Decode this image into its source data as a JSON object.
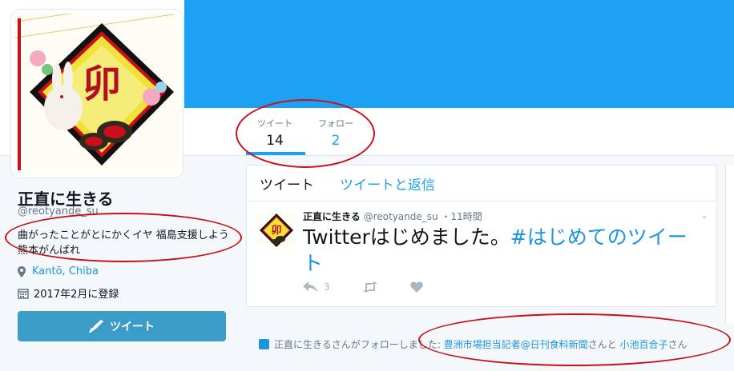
{
  "profile": {
    "name": "正直に生きる",
    "handle": "@reotyande_su",
    "bio": "曲がったことがとにかくイヤ 福島支援しよう 熊本がんばれ",
    "location": "Kantō, Chiba",
    "joined": "2017年2月に登録",
    "avatar_kanji": "卯",
    "tweet_button_label": "ツイート"
  },
  "stats": {
    "tweets_label": "ツイート",
    "tweets_value": "14",
    "following_label": "フォロー",
    "following_value": "2"
  },
  "timeline": {
    "tabs": [
      "ツイート",
      "ツイートと返信"
    ],
    "tweet": {
      "author": "正直に生きる",
      "handle": "@reotyande_su",
      "time": "・11時間",
      "text": "Twitterはじめました。",
      "hashtag": "#はじめてのツイート",
      "reply_count": "3"
    }
  },
  "follow_notice": {
    "prefix": "正直に生きるさんがフォローしました: ",
    "account1": "豊洲市場担当記者@日刊食料新聞",
    "middle": "さんと ",
    "account2": "小池百合子",
    "suffix": "さん"
  },
  "colors": {
    "accent": "#1da1f2",
    "tweet_button": "#3a9cc7",
    "annotation": "#c8101a"
  }
}
